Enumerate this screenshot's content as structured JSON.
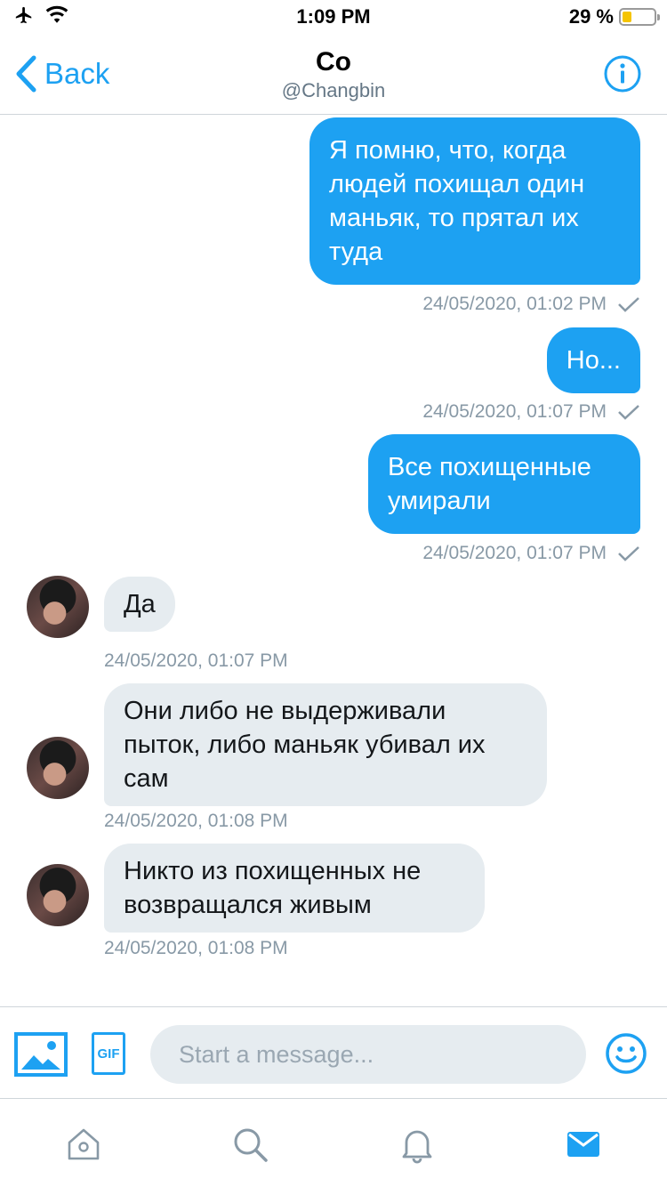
{
  "status_bar": {
    "time": "1:09 PM",
    "battery_text": "29 %",
    "battery_level": 0.29,
    "icons": [
      "airplane-icon",
      "wifi-icon",
      "battery-icon"
    ]
  },
  "header": {
    "back_label": "Back",
    "title": "Co",
    "handle": "@Changbin",
    "info_icon": "info-icon"
  },
  "colors": {
    "accent": "#1da1f2",
    "incoming_bubble": "#e6ecf0",
    "timestamp": "#8899a6",
    "battery_fill": "#f5c400"
  },
  "messages": [
    {
      "direction": "out",
      "text": "Я помню, что, когда людей похищал один маньяк, то прятал их туда",
      "timestamp": "24/05/2020, 01:02 PM",
      "read": true
    },
    {
      "direction": "out",
      "text": "Но...",
      "timestamp": "24/05/2020, 01:07 PM",
      "read": true
    },
    {
      "direction": "out",
      "text": "Все похищенные умирали",
      "timestamp": "24/05/2020, 01:07 PM",
      "read": true
    },
    {
      "direction": "in",
      "text": "Да",
      "timestamp": "24/05/2020, 01:07 PM"
    },
    {
      "direction": "in",
      "text": "Они либо не выдерживали пыток, либо маньяк убивал их сам",
      "timestamp": "24/05/2020, 01:08 PM"
    },
    {
      "direction": "in",
      "text": "Никто из похищенных не возвращался живым",
      "timestamp": "24/05/2020, 01:08 PM"
    }
  ],
  "composer": {
    "placeholder": "Start a message...",
    "gif_label": "GIF",
    "icons": [
      "image-icon",
      "gif-icon",
      "emoji-icon"
    ]
  },
  "tabbar": {
    "items": [
      "home-icon",
      "search-icon",
      "notifications-icon",
      "messages-icon"
    ],
    "active": "messages-icon"
  }
}
